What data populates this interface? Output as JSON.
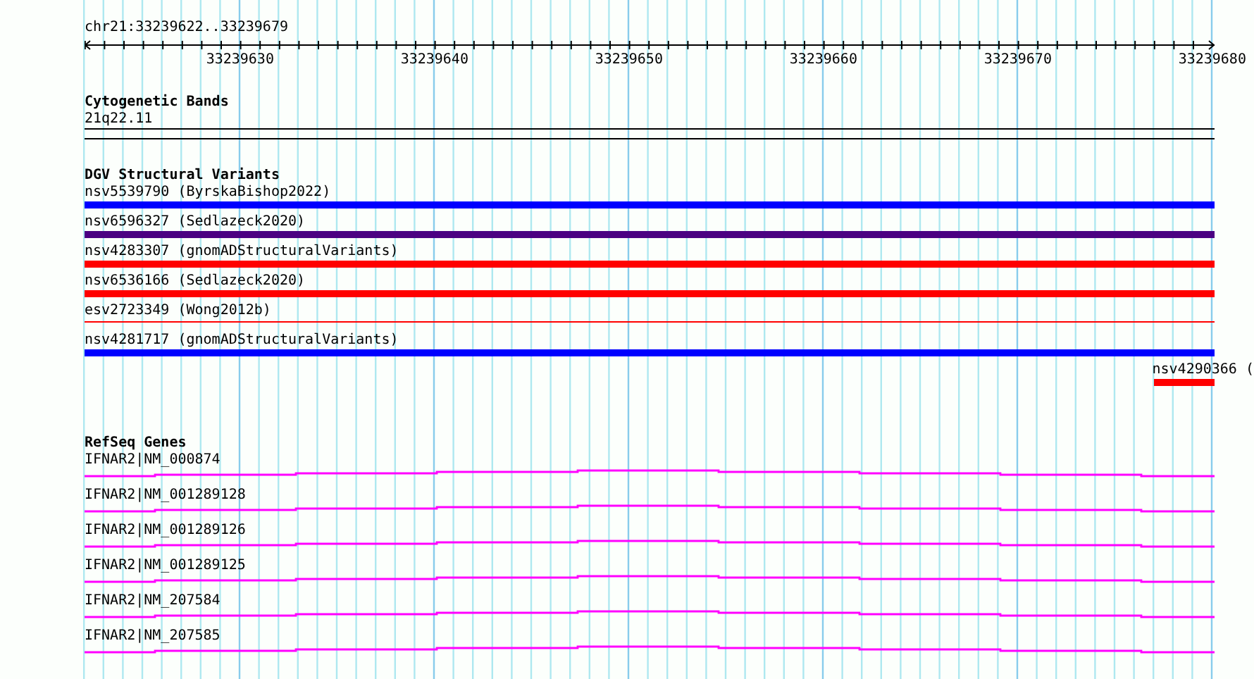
{
  "ruler": {
    "location": "chr21:33239622..33239679",
    "tick_labels": [
      "33239630",
      "33239640",
      "33239650",
      "33239660",
      "33239670",
      "33239680"
    ]
  },
  "tracks": [
    {
      "kind": "bands",
      "title": "Cytogenetic Bands",
      "features": [
        {
          "label": "21q22.11"
        }
      ]
    },
    {
      "kind": "variants",
      "title": "DGV Structural Variants",
      "features": [
        {
          "label": "nsv5539790 (ByrskaBishop2022)",
          "kind": "bar",
          "color": "#0000ff"
        },
        {
          "label": "nsv6596327 (Sedlazeck2020)",
          "kind": "bar",
          "color": "#4b0082"
        },
        {
          "label": "nsv4283307 (gnomADStructuralVariants)",
          "kind": "bar",
          "color": "#ff0000"
        },
        {
          "label": "nsv6536166 (Sedlazeck2020)",
          "kind": "bar",
          "color": "#ff0000"
        },
        {
          "label": "esv2723349 (Wong2012b)",
          "kind": "line",
          "color": "#ff0000"
        },
        {
          "label": "nsv4281717 (gnomADStructuralVariants)",
          "kind": "bar",
          "color": "#0000ff"
        },
        {
          "label": "nsv4290366 (",
          "kind": "edge",
          "color": "#ff0000"
        }
      ]
    },
    {
      "kind": "genes",
      "title": "RefSeq Genes",
      "features": [
        {
          "label": "IFNAR2|NM_000874"
        },
        {
          "label": "IFNAR2|NM_001289128"
        },
        {
          "label": "IFNAR2|NM_001289126"
        },
        {
          "label": "IFNAR2|NM_001289125"
        },
        {
          "label": "IFNAR2|NM_207584"
        },
        {
          "label": "IFNAR2|NM_207585"
        }
      ]
    }
  ]
}
